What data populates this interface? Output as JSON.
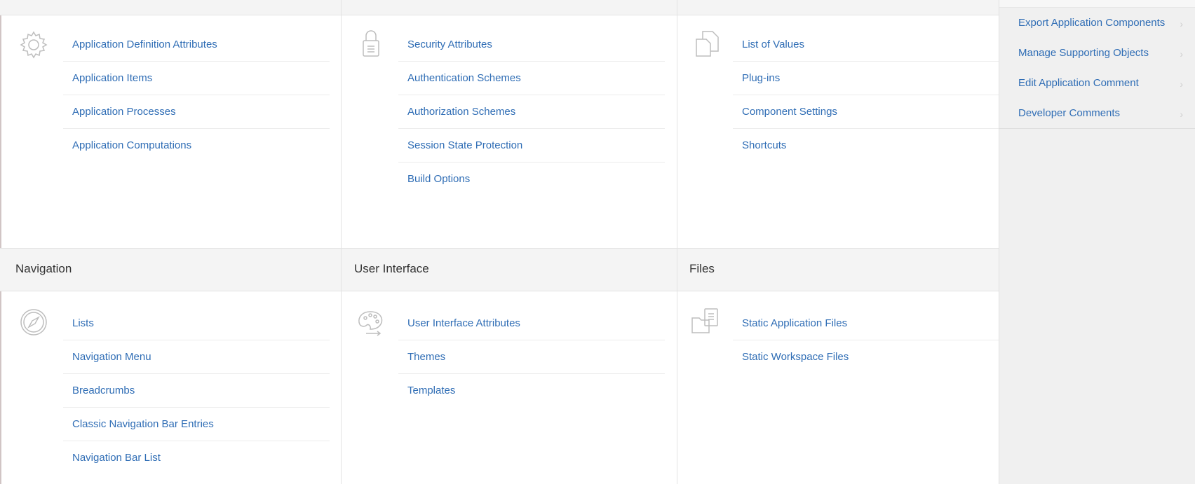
{
  "sections": [
    {
      "id": "application-logic",
      "icon": "gear-icon",
      "items": [
        "Application Definition Attributes",
        "Application Items",
        "Application Processes",
        "Application Computations"
      ]
    },
    {
      "id": "security",
      "icon": "lock-icon",
      "items": [
        "Security Attributes",
        "Authentication Schemes",
        "Authorization Schemes",
        "Session State Protection",
        "Build Options"
      ]
    },
    {
      "id": "other-components",
      "icon": "copy-icon",
      "items": [
        "List of Values",
        "Plug-ins",
        "Component Settings",
        "Shortcuts"
      ]
    },
    {
      "id": "navigation",
      "title": "Navigation",
      "icon": "compass-icon",
      "items": [
        "Lists",
        "Navigation Menu",
        "Breadcrumbs",
        "Classic Navigation Bar Entries",
        "Navigation Bar List"
      ]
    },
    {
      "id": "user-interface",
      "title": "User Interface",
      "icon": "palette-icon",
      "items": [
        "User Interface Attributes",
        "Themes",
        "Templates"
      ]
    },
    {
      "id": "files",
      "title": "Files",
      "icon": "file-folder-icon",
      "items": [
        "Static Application Files",
        "Static Workspace Files"
      ]
    }
  ],
  "sidebar": {
    "items": [
      {
        "label": "Export Application Components"
      },
      {
        "label": "Manage Supporting Objects"
      },
      {
        "label": "Edit Application Comment"
      },
      {
        "label": "Developer Comments"
      }
    ],
    "chevron": "›"
  },
  "colors": {
    "link": "#2f6db5",
    "band": "#f4f4f4",
    "sidebar": "#f0f0f0"
  }
}
